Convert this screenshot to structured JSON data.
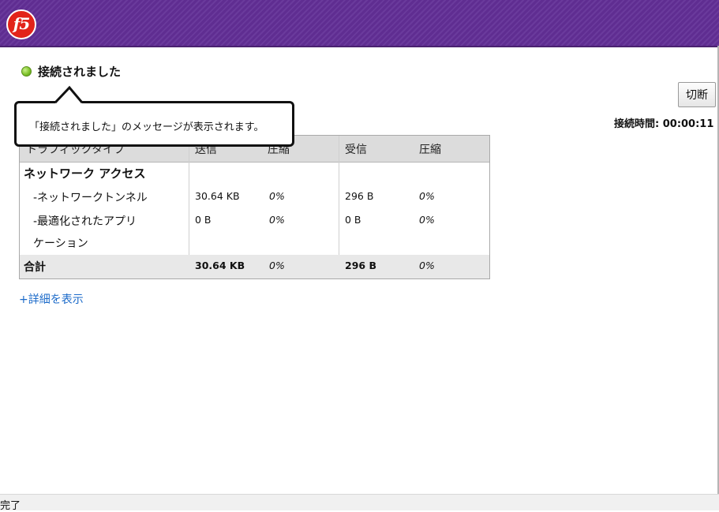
{
  "header": {
    "logo_text": "f5",
    "brand_color": "#5f2d91",
    "logo_color": "#e2231a"
  },
  "status": {
    "text": "接続されました",
    "dot_color": "#7fc32b"
  },
  "disconnect_button": {
    "label": "切断"
  },
  "connection_time": {
    "label": "接続時間: 00:00:11"
  },
  "callout": {
    "text": "「接続されました」のメッセージが表示されます。"
  },
  "table": {
    "headers": {
      "traffic_type": "トラフィックタイプ",
      "sent": "送信",
      "sent_compression": "圧縮",
      "received": "受信",
      "received_compression": "圧縮"
    },
    "group": "ネットワーク アクセス",
    "rows": [
      {
        "name": "-ネットワークトンネル",
        "sent": "30.64 KB",
        "sent_compression": "0%",
        "received": "296 B",
        "received_compression": "0%"
      },
      {
        "name_line1": "-最適化されたアプリ",
        "name_line2": "ケーション",
        "sent": "0 B",
        "sent_compression": "0%",
        "received": "0 B",
        "received_compression": "0%"
      }
    ],
    "total": {
      "label": "合計",
      "sent": "30.64 KB",
      "sent_compression": "0%",
      "received": "296 B",
      "received_compression": "0%"
    }
  },
  "details_link": {
    "label": "+詳細を表示"
  },
  "statusbar": {
    "text": "完了"
  }
}
